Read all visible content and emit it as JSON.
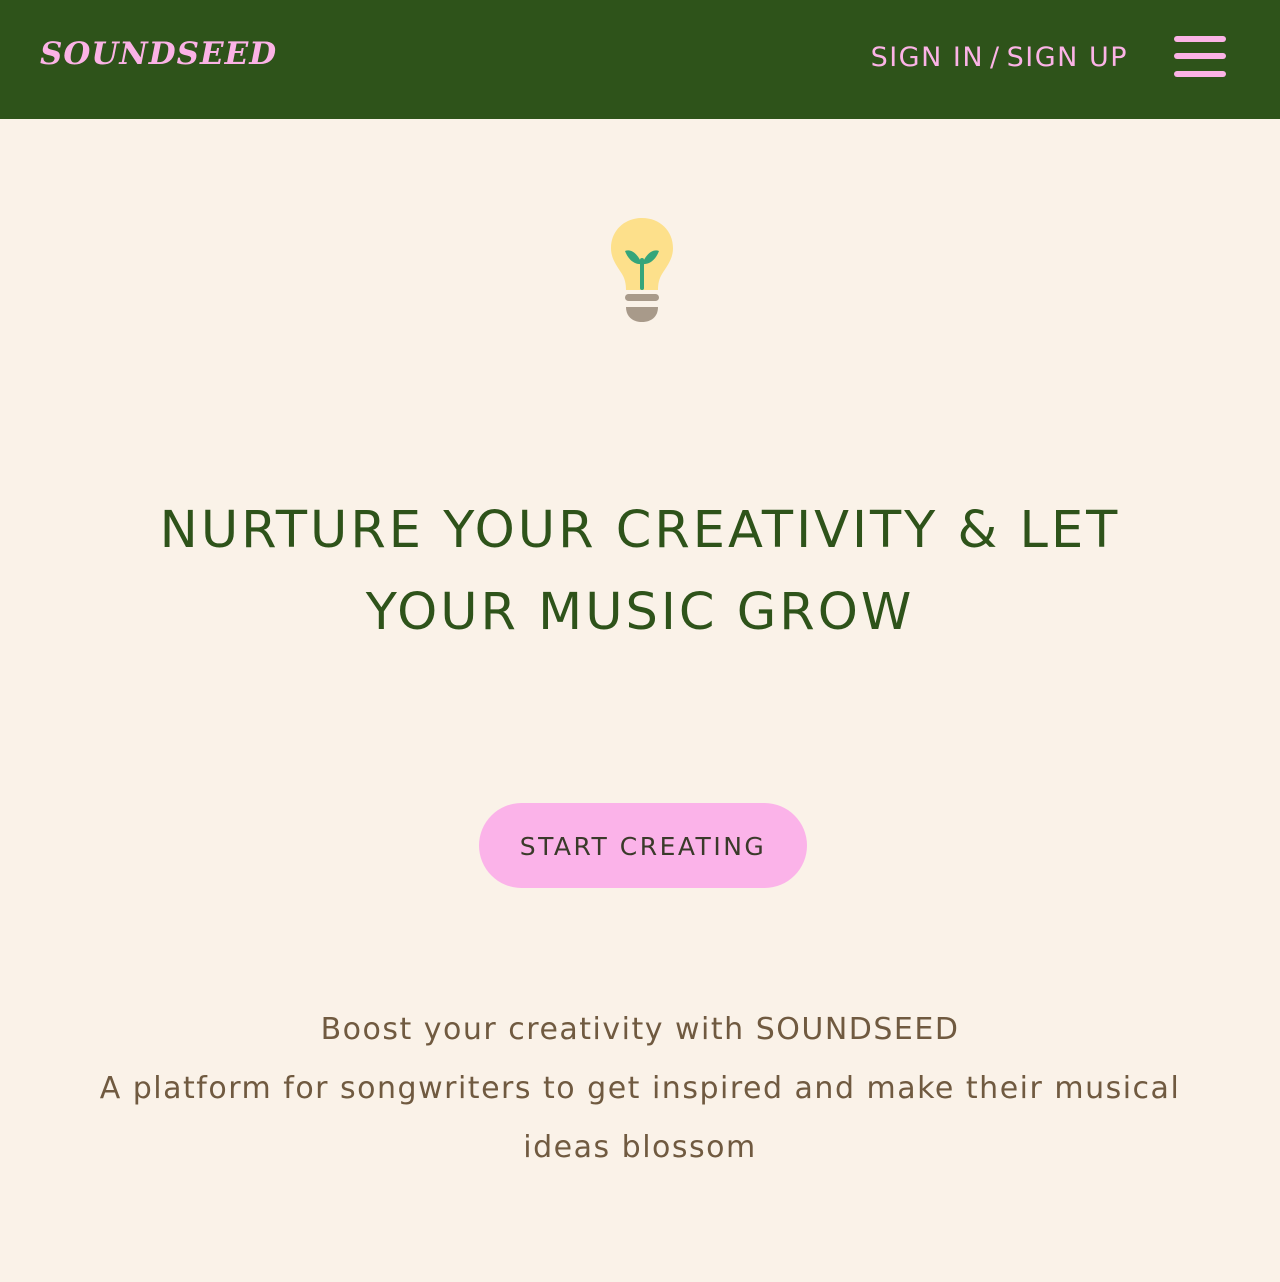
{
  "header": {
    "logo": "SOUNDSEED",
    "sign_in": "SIGN IN",
    "separator": "/",
    "sign_up": "SIGN UP",
    "menu_icon": "hamburger-menu-icon"
  },
  "hero": {
    "icon": "lightbulb-sprout-icon",
    "headline": "NURTURE YOUR CREATIVITY & LET YOUR MUSIC GROW",
    "cta_label": "START CREATING",
    "tagline_line1": "Boost your creativity with SOUNDSEED",
    "tagline_line2": "A platform for songwriters to get inspired and make their musical ideas blossom"
  },
  "colors": {
    "header_bg": "#2E531A",
    "page_bg": "#FAF2E8",
    "accent_pink": "#FBB3E6",
    "headline_green": "#2E531A",
    "body_brown": "#705A40"
  }
}
